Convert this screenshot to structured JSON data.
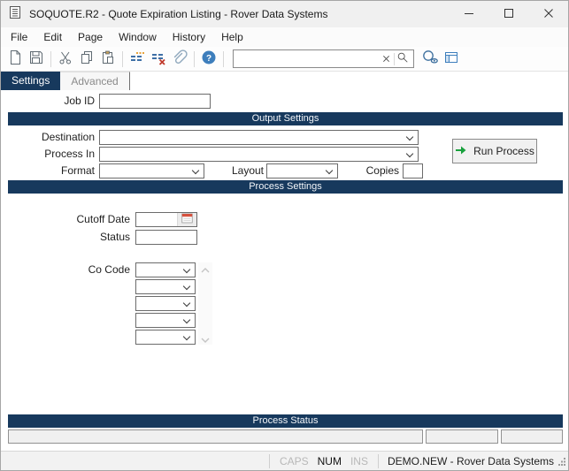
{
  "window": {
    "title": "SOQUOTE.R2 - Quote Expiration Listing - Rover Data Systems"
  },
  "menu": {
    "items": [
      "File",
      "Edit",
      "Page",
      "Window",
      "History",
      "Help"
    ]
  },
  "toolbar": {
    "search_value": ""
  },
  "tabs": {
    "settings": "Settings",
    "advanced": "Advanced"
  },
  "form": {
    "job_id_label": "Job ID",
    "job_id_value": "",
    "output": {
      "header": "Output Settings",
      "destination_label": "Destination",
      "process_in_label": "Process In",
      "format_label": "Format",
      "layout_label": "Layout",
      "copies_label": "Copies",
      "copies_value": "",
      "run_button_label": "Run Process"
    },
    "process": {
      "header": "Process Settings",
      "cutoff_date_label": "Cutoff Date",
      "cutoff_date_value": "",
      "status_label": "Status",
      "status_value": "",
      "co_code_label": "Co Code",
      "co_code_count": 5
    },
    "process_status_header": "Process Status"
  },
  "status_bar": {
    "caps": "CAPS",
    "num": "NUM",
    "ins": "INS",
    "session": "DEMO.NEW - Rover Data Systems"
  },
  "colors": {
    "navy": "#17395d",
    "accent_blue": "#3d7ebc",
    "run_green": "#18a03c",
    "calendar_red": "#d6523f"
  },
  "icons": {
    "titlebar": "document-icon",
    "toolbar": [
      "new-icon",
      "save-icon",
      "cut-icon",
      "copy-icon",
      "paste-icon",
      "add-detail-icon",
      "delete-detail-icon",
      "attach-icon",
      "help-icon",
      "clear-search-icon",
      "search-icon",
      "find-preview-icon",
      "layout-icon"
    ],
    "window_controls": [
      "minimize-icon",
      "maximize-icon",
      "close-icon"
    ],
    "other": [
      "calendar-icon",
      "scroll-up-icon",
      "scroll-down-icon",
      "run-arrow-icon",
      "resize-grip"
    ]
  }
}
